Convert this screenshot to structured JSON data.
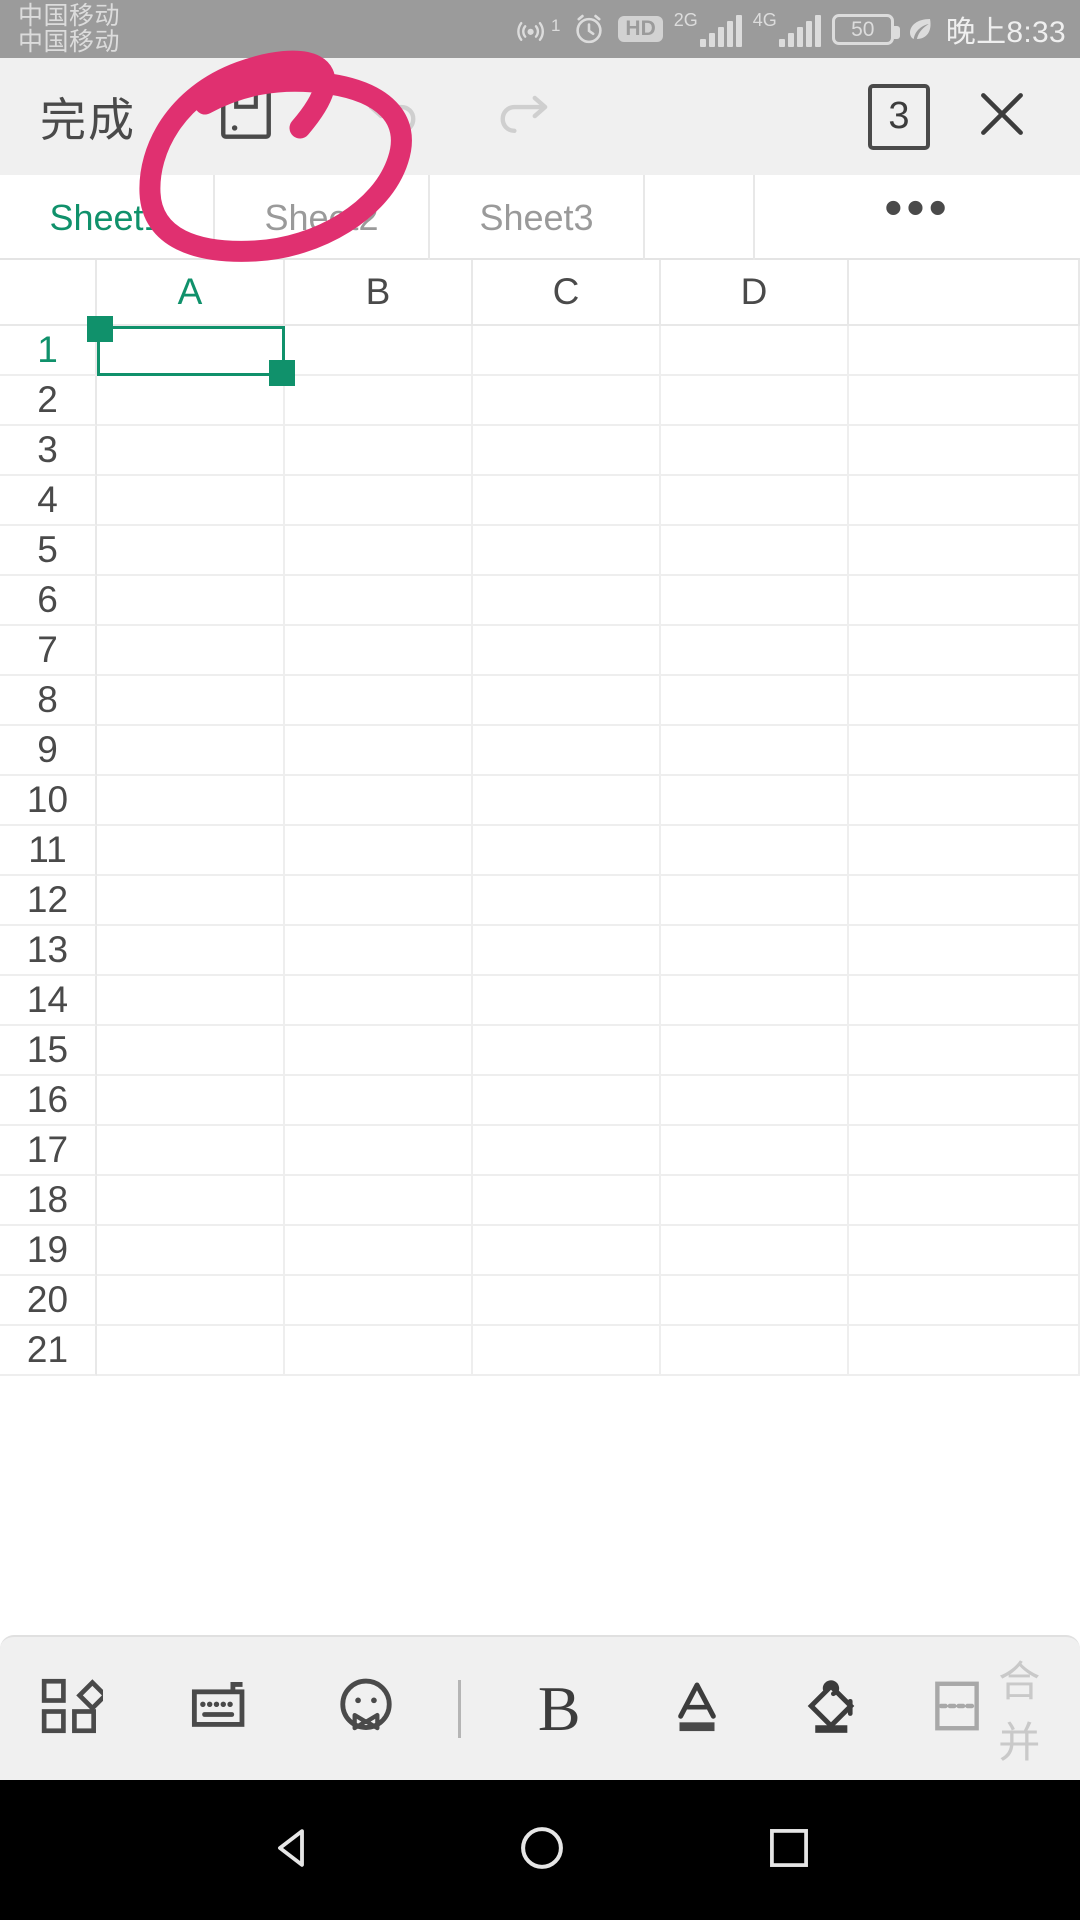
{
  "status_bar": {
    "carrier_lines": [
      "中国移动",
      "中国移动"
    ],
    "hotspot_superscript": "1",
    "hd_label": "HD",
    "network_1": "2G",
    "network_2": "4G",
    "battery_percent": "50",
    "time": "晚上8:33",
    "icons": [
      "hotspot-icon",
      "alarm-clock-icon",
      "hd-icon",
      "signal-2g-icon",
      "signal-4g-icon",
      "battery-icon",
      "leaf-icon"
    ],
    "bg_color": "#9b9b9b",
    "fg_color": "#dcdcdc"
  },
  "top_toolbar": {
    "done_label": "完成",
    "save_icon": "save-floppy-icon",
    "undo_icon": "undo-icon",
    "redo_icon": "redo-icon",
    "doc_count": "3",
    "close_icon": "close-x-icon",
    "bg_color": "#f0f0f0",
    "disabled_color": "#cccccc"
  },
  "sheet_tabs": {
    "tabs": [
      {
        "label": "Sheet1",
        "active": true
      },
      {
        "label": "Sheet2",
        "active": false
      },
      {
        "label": "Sheet3",
        "active": false
      }
    ],
    "more_label": "•••",
    "active_color": "#10916b",
    "inactive_color": "#9a9a9a"
  },
  "grid": {
    "columns": [
      "A",
      "B",
      "C",
      "D"
    ],
    "selected_column": "A",
    "rows": [
      "1",
      "2",
      "3",
      "4",
      "5",
      "6",
      "7",
      "8",
      "9",
      "10",
      "11",
      "12",
      "13",
      "14",
      "15",
      "16",
      "17",
      "18",
      "19",
      "20",
      "21"
    ],
    "selected_row": "1",
    "selection_range": "A1",
    "selection_color": "#10916b",
    "gridline_color": "#eeeeee",
    "cell_values": []
  },
  "bottom_toolbar": {
    "items": [
      {
        "name": "tools-grid-icon",
        "label": ""
      },
      {
        "name": "keyboard-icon",
        "label": ""
      },
      {
        "name": "emoji-icon",
        "label": ""
      },
      {
        "name": "divider",
        "label": ""
      },
      {
        "name": "bold-icon",
        "label": "B"
      },
      {
        "name": "font-color-icon",
        "label": "A"
      },
      {
        "name": "fill-color-icon",
        "label": ""
      },
      {
        "name": "merge-cells-icon",
        "label": "合并"
      }
    ],
    "merge_label": "合并",
    "bold_label": "B",
    "font_color_label": "A",
    "disabled_color": "#c9c9c9",
    "bg_color": "#f0f0f0"
  },
  "nav_bar": {
    "back_icon": "back-triangle-icon",
    "home_icon": "home-circle-icon",
    "recents_icon": "recents-square-icon",
    "bg_color": "#000000"
  },
  "annotation": {
    "type": "hand-drawn-circle",
    "color": "#e03070",
    "target": "save-button"
  }
}
